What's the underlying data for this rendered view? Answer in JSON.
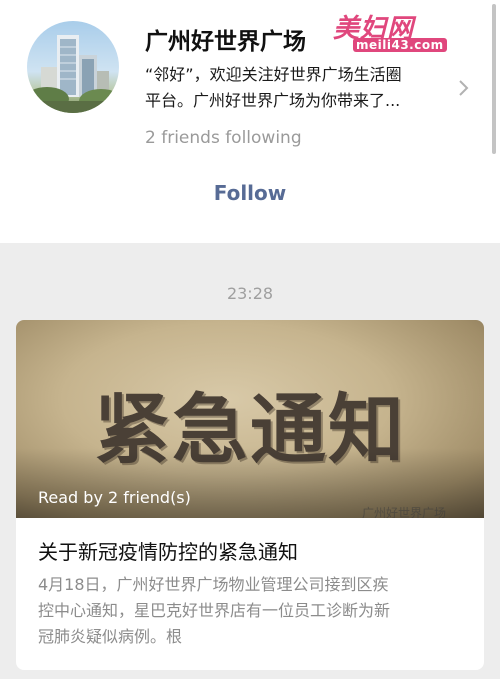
{
  "account": {
    "name": "广州好世界广场",
    "intro_lines": [
      "“邻好”，欢迎关注好世界广场生活圈",
      "平台。广州好世界广场为你带来了..."
    ],
    "friends_following": "2 friends following",
    "follow_label": "Follow",
    "avatar_icon": "building-photo",
    "chevron_icon": "chevron-right-icon"
  },
  "watermark": {
    "logo_text": "美妇网",
    "domain": "meili43.com"
  },
  "feed": {
    "timestamp": "23:28",
    "article": {
      "cover_text": "紧急通知",
      "read_by": "Read by 2 friend(s)",
      "cover_mark": "广州好世界广场",
      "title": "关于新冠疫情防控的紧急通知",
      "summary_lines": [
        "4月18日，广州好世界广场物业管理公司接到区疾",
        "控中心通知，星巴克好世界店有一位员工诊断为新",
        "冠肺炎疑似病例。根"
      ]
    }
  },
  "colors": {
    "follow_link": "#576b95",
    "secondary_text": "#9a9a9a",
    "background": "#ededed",
    "watermark": "#e0477d"
  }
}
